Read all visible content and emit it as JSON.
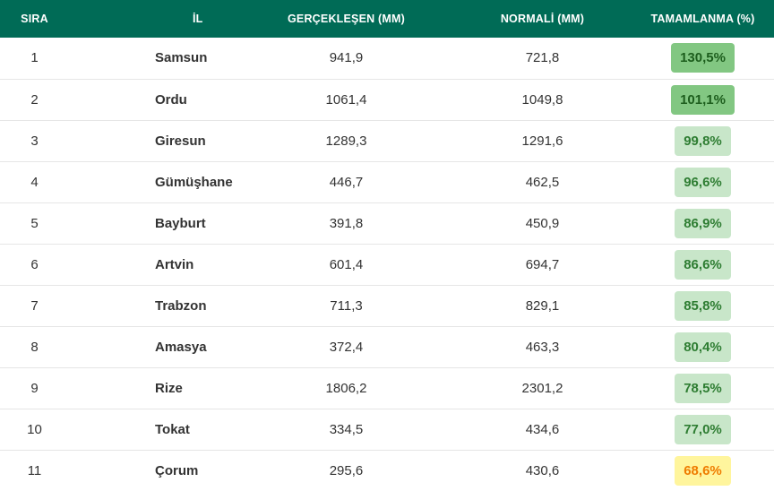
{
  "table": {
    "headers": {
      "sira": "SIRA",
      "il": "İL",
      "gerceklesen": "GERÇEKLEŞEN (MM)",
      "normali": "NORMALİ (MM)",
      "tamamlanma": "TAMAMLANMA (%)"
    },
    "rows": [
      {
        "sira": "1",
        "il": "Samsun",
        "gerceklesen": "941,9",
        "normali": "721,8",
        "tamamlanma": "130,5%",
        "level": "high"
      },
      {
        "sira": "2",
        "il": "Ordu",
        "gerceklesen": "1061,4",
        "normali": "1049,8",
        "tamamlanma": "101,1%",
        "level": "high"
      },
      {
        "sira": "3",
        "il": "Giresun",
        "gerceklesen": "1289,3",
        "normali": "1291,6",
        "tamamlanma": "99,8%",
        "level": "good"
      },
      {
        "sira": "4",
        "il": "Gümüşhane",
        "gerceklesen": "446,7",
        "normali": "462,5",
        "tamamlanma": "96,6%",
        "level": "good"
      },
      {
        "sira": "5",
        "il": "Bayburt",
        "gerceklesen": "391,8",
        "normali": "450,9",
        "tamamlanma": "86,9%",
        "level": "good"
      },
      {
        "sira": "6",
        "il": "Artvin",
        "gerceklesen": "601,4",
        "normali": "694,7",
        "tamamlanma": "86,6%",
        "level": "good"
      },
      {
        "sira": "7",
        "il": "Trabzon",
        "gerceklesen": "711,3",
        "normali": "829,1",
        "tamamlanma": "85,8%",
        "level": "good"
      },
      {
        "sira": "8",
        "il": "Amasya",
        "gerceklesen": "372,4",
        "normali": "463,3",
        "tamamlanma": "80,4%",
        "level": "good"
      },
      {
        "sira": "9",
        "il": "Rize",
        "gerceklesen": "1806,2",
        "normali": "2301,2",
        "tamamlanma": "78,5%",
        "level": "good"
      },
      {
        "sira": "10",
        "il": "Tokat",
        "gerceklesen": "334,5",
        "normali": "434,6",
        "tamamlanma": "77,0%",
        "level": "good"
      },
      {
        "sira": "11",
        "il": "Çorum",
        "gerceklesen": "295,6",
        "normali": "430,6",
        "tamamlanma": "68,6%",
        "level": "warn"
      }
    ]
  },
  "colors": {
    "header_bg": "#006b56",
    "badge_high_bg": "#82c782",
    "badge_good_bg": "#c8e6c9",
    "badge_warn_bg": "#fff59d",
    "badge_warn_text": "#ef7c00"
  }
}
